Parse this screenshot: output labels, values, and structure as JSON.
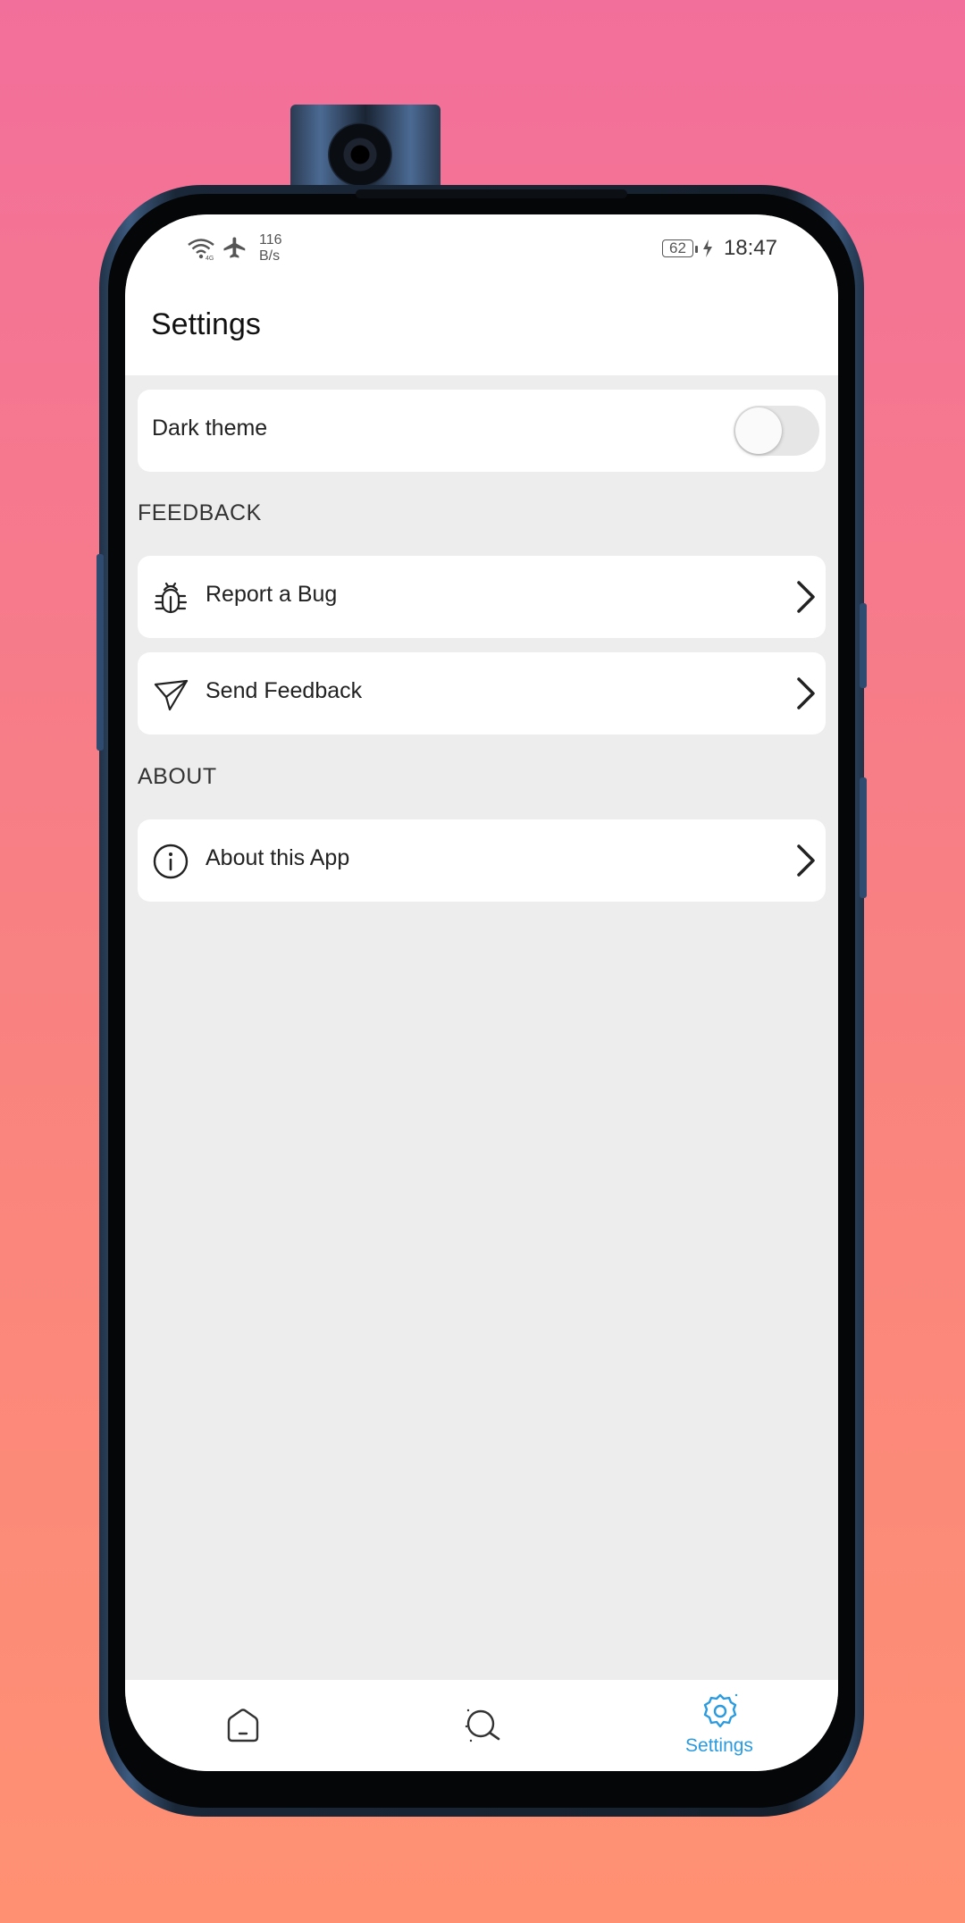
{
  "status_bar": {
    "net_speed_value": "116",
    "net_speed_unit": "B/s",
    "battery_level": "62",
    "time": "18:47",
    "icons": [
      "wifi-icon",
      "airplane-mode-icon",
      "battery-icon",
      "charging-icon"
    ]
  },
  "app_bar": {
    "title": "Settings"
  },
  "appearance": {
    "dark_theme_label": "Dark theme",
    "dark_theme_enabled": false
  },
  "feedback_section": {
    "header": "FEEDBACK",
    "items": [
      {
        "label": "Report a Bug",
        "icon": "bug-icon"
      },
      {
        "label": "Send Feedback",
        "icon": "send-icon"
      }
    ]
  },
  "about_section": {
    "header": "ABOUT",
    "items": [
      {
        "label": "About this App",
        "icon": "info-icon"
      }
    ]
  },
  "bottom_nav": {
    "items": [
      {
        "icon": "home-icon",
        "label": "",
        "active": false
      },
      {
        "icon": "search-icon",
        "label": "",
        "active": false
      },
      {
        "icon": "settings-gear-icon",
        "label": "Settings",
        "active": true
      }
    ]
  },
  "colors": {
    "accent": "#2b9be0",
    "background_top": "#f26f9b",
    "background_bottom": "#ff9172",
    "surface": "#ffffff",
    "page_bg": "#ededed"
  }
}
